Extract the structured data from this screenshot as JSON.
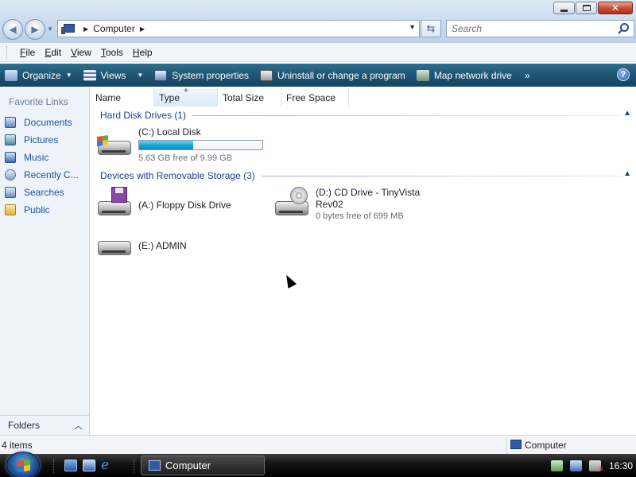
{
  "window": {
    "minimize_icon": "minimize-icon",
    "maximize_icon": "maximize-icon",
    "close_icon": "close-icon"
  },
  "address_bar": {
    "path": "Computer",
    "back_icon": "back-arrow-icon",
    "forward_icon": "forward-arrow-icon",
    "refresh_icon": "refresh-icon"
  },
  "search": {
    "placeholder": "Search"
  },
  "menu": {
    "items": [
      {
        "key": "F",
        "rest": "ile"
      },
      {
        "key": "E",
        "rest": "dit"
      },
      {
        "key": "V",
        "rest": "iew"
      },
      {
        "key": "T",
        "rest": "ools"
      },
      {
        "key": "H",
        "rest": "elp"
      }
    ]
  },
  "commands": {
    "organize": "Organize",
    "views": "Views",
    "system_properties": "System properties",
    "uninstall": "Uninstall or change a program",
    "map_drive": "Map network drive",
    "more": "»",
    "help": "?"
  },
  "sidebar": {
    "title": "Favorite Links",
    "items": [
      {
        "label": "Documents",
        "icon": "documents-icon"
      },
      {
        "label": "Pictures",
        "icon": "pictures-icon"
      },
      {
        "label": "Music",
        "icon": "music-icon"
      },
      {
        "label": "Recently C...",
        "icon": "recent-icon"
      },
      {
        "label": "Searches",
        "icon": "searches-icon"
      },
      {
        "label": "Public",
        "icon": "public-folder-icon"
      }
    ],
    "folders_label": "Folders"
  },
  "columns": [
    "Name",
    "Type",
    "Total Size",
    "Free Space"
  ],
  "groups": {
    "hard_disks": {
      "title": "Hard Disk Drives (1)",
      "drives": [
        {
          "name": "(C:) Local Disk",
          "free": "5.63 GB free of 9.99 GB",
          "used_fraction": 0.44
        }
      ]
    },
    "removable": {
      "title": "Devices with Removable Storage (3)",
      "drives": [
        {
          "name": "(A:) Floppy Disk Drive"
        },
        {
          "name": "(D:) CD Drive - TinyVista",
          "name2": "Rev02",
          "free": "0 bytes free of 699 MB"
        },
        {
          "name": "(E:) ADMIN"
        }
      ]
    }
  },
  "status": {
    "count": "4 items",
    "location": "Computer"
  },
  "taskbar": {
    "task_label": "Computer",
    "clock": "16:30"
  },
  "colors": {
    "accent": "#1f5473",
    "link": "#1f4fa0",
    "group_header": "#1d3f8f",
    "progress": "#1ba7d6"
  }
}
